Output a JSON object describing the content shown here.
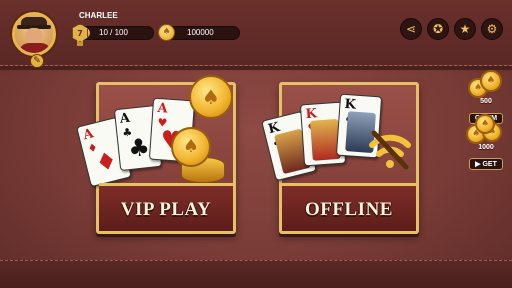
{
  "player": {
    "name": "CHARLEE",
    "level": "7",
    "xp_text": "10 / 100",
    "xp_fraction": 0.1,
    "coins": "100000"
  },
  "top_icons": [
    {
      "name": "share-icon",
      "glyph": "⋖"
    },
    {
      "name": "achievement-medal-icon",
      "glyph": "✪"
    },
    {
      "name": "star-icon",
      "glyph": "★"
    },
    {
      "name": "settings-gear-icon",
      "glyph": "⚙"
    }
  ],
  "modes": {
    "vip": {
      "label": "VIP PLAY"
    },
    "offline": {
      "label": "OFFLINE"
    }
  },
  "cards": {
    "vip": [
      {
        "rank": "A",
        "suit": "♦",
        "color": "red"
      },
      {
        "rank": "A",
        "suit": "♣",
        "color": "blk"
      },
      {
        "rank": "A",
        "suit": "♥",
        "color": "red"
      }
    ],
    "offline": [
      {
        "rank": "K",
        "suit": "♣",
        "color": "blk"
      },
      {
        "rank": "K",
        "suit": "♥",
        "color": "red"
      },
      {
        "rank": "K",
        "suit": "♠",
        "color": "blk"
      }
    ]
  },
  "rewards": {
    "claim": {
      "amount": "500",
      "button": "CLAIM"
    },
    "get": {
      "amount": "1000",
      "button": "GET"
    }
  },
  "colors": {
    "accent_gold": "#e6c067",
    "felt_red": "#7a3d38"
  }
}
